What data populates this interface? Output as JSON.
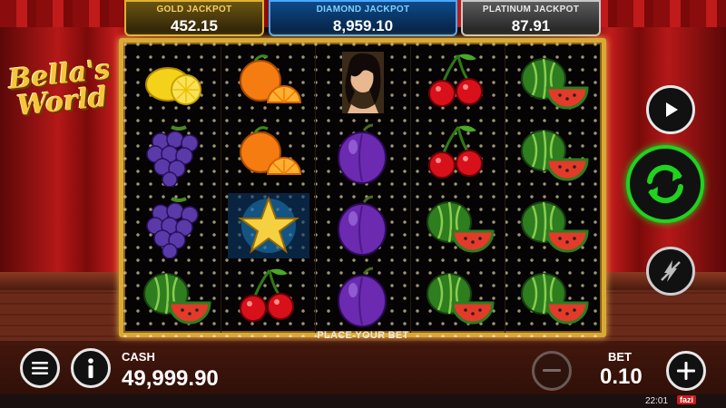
{
  "game": {
    "logo": "Bella's World"
  },
  "jackpots": [
    {
      "label": "GOLD JACKPOT",
      "value": "452.15"
    },
    {
      "label": "DIAMOND JACKPOT",
      "value": "8,959.10"
    },
    {
      "label": "PLATINUM JACKPOT",
      "value": "87.91"
    }
  ],
  "reels": [
    [
      "lemon",
      "grapes",
      "grapes",
      "watermelon"
    ],
    [
      "orange",
      "orange",
      "star",
      "cherry"
    ],
    [
      "bella",
      "plum",
      "plum",
      "plum"
    ],
    [
      "cherry",
      "cherry",
      "watermelon",
      "watermelon"
    ],
    [
      "watermelon",
      "watermelon",
      "watermelon",
      "watermelon"
    ]
  ],
  "message": "PLACE YOUR BET",
  "cash": {
    "label": "CASH",
    "value": "49,999.90"
  },
  "bet": {
    "label": "BET",
    "value": "0.10"
  },
  "status": {
    "clock": "22:01",
    "brand": "fazi"
  },
  "icons": {
    "play": "play-icon",
    "spin": "spin-arrows-icon",
    "turbo": "lightning-off-icon",
    "menu": "hamburger-icon",
    "info": "info-icon",
    "minus": "minus-icon",
    "plus": "plus-icon"
  },
  "colors": {
    "spin_accent": "#1fd31f",
    "gold": "#e0b030",
    "diamond": "#4aa8ff",
    "platinum": "#c8c8c8"
  }
}
